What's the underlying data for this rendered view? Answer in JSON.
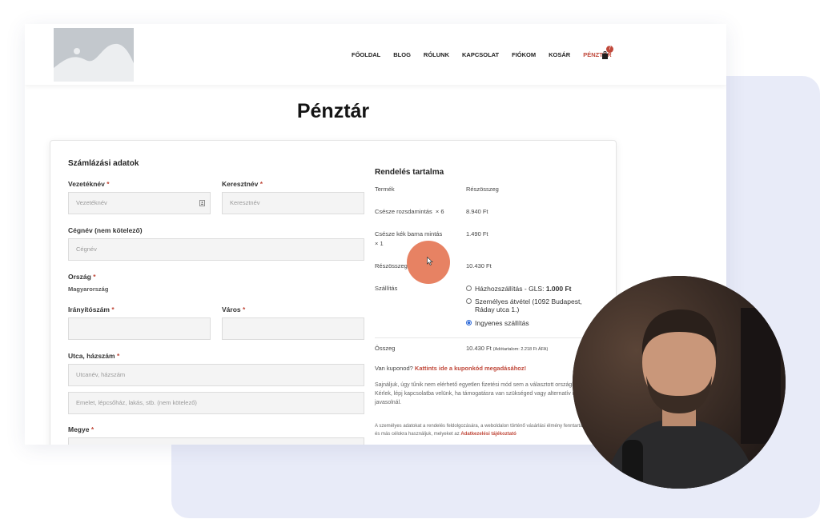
{
  "header": {
    "nav": [
      "FŐOLDAL",
      "BLOG",
      "RÓLUNK",
      "KAPCSOLAT",
      "FIÓKOM",
      "KOSÁR",
      "PÉNZTÁR"
    ],
    "cart_count": "7"
  },
  "page_title": "Pénztár",
  "billing": {
    "title": "Számlázási adatok",
    "required_mark": "*",
    "lastname_label": "Vezetéknév",
    "lastname_placeholder": "Vezetéknév",
    "firstname_label": "Keresztnév",
    "firstname_placeholder": "Keresztnév",
    "company_label": "Cégnév (nem kötelező)",
    "company_placeholder": "Cégnév",
    "country_label": "Ország",
    "country_value": "Magyarország",
    "zip_label": "Irányítószám",
    "city_label": "Város",
    "street_label": "Utca, házszám",
    "street_placeholder": "Utcanév, házszám",
    "street2_placeholder": "Emelet, lépcsőház, lakás, stb. (nem kötelező)",
    "county_label": "Megye"
  },
  "order": {
    "title": "Rendelés tartalma",
    "col_product": "Termék",
    "col_subtotal": "Részösszeg",
    "items": [
      {
        "name": "Csésze rozsdamintás",
        "qty": "× 6",
        "price": "8.940 Ft"
      },
      {
        "name": "Csésze kék barna mintás",
        "qty": "× 1",
        "price": "1.490 Ft"
      }
    ],
    "subtotal_label": "Részösszeg",
    "subtotal_value": "10.430 Ft",
    "shipping_label": "Szállítás",
    "shipping_options": [
      {
        "label": "Házhozszállítás - GLS:",
        "price": "1.000 Ft",
        "selected": false
      },
      {
        "label": "Személyes átvétel (1092 Budapest, Ráday utca 1.)",
        "price": "",
        "selected": false
      },
      {
        "label": "Ingyenes szállítás",
        "price": "",
        "selected": true
      }
    ],
    "total_label": "Összeg",
    "total_value": "10.430 Ft",
    "total_tax": "(Adótartalom: 2.218 Ft ÁFA)",
    "coupon_text": "Van kuponod?",
    "coupon_link": "Kattints ide a kuponkód megadásához!",
    "no_payment_text": "Sajnáljuk, úgy tűnik nem elérhető egyetlen fizetési mód sem a választott országban. Kérlek, lépj kapcsolatba velünk, ha támogatásra van szükséged vagy alternatív megoldást javasolnál.",
    "privacy_text": "A személyes adatokat a rendelés feldolgozására, a weboldalon történő vásárlási élmény fenntartásához és más célokra használjuk, melyeket az",
    "privacy_link": "Adatkezelési tájékoztató"
  },
  "colors": {
    "accent": "#c0483a",
    "background_panel": "#e8ebf8",
    "cursor_highlight": "#e36c48"
  }
}
